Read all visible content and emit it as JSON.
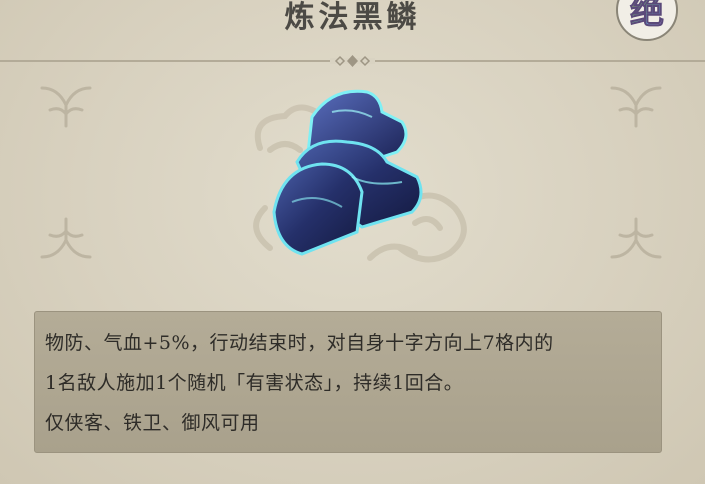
{
  "item": {
    "name": "炼法黑鳞",
    "rarity_char": "绝",
    "icon": "dark-blue-armor-scale-icon"
  },
  "description": {
    "line1": "物防、气血+5%，行动结束时，对自身十字方向上7格内的",
    "line2": "1名敌人施加1个随机「有害状态」，持续1回合。",
    "line3": "仅侠客、铁卫、御风可用"
  },
  "colors": {
    "background": "#d9d3c2",
    "title_text": "#4c4a45",
    "desc_box": "#aea690",
    "armor": "#2a3a78",
    "armor_glow": "#6fe3f0"
  }
}
